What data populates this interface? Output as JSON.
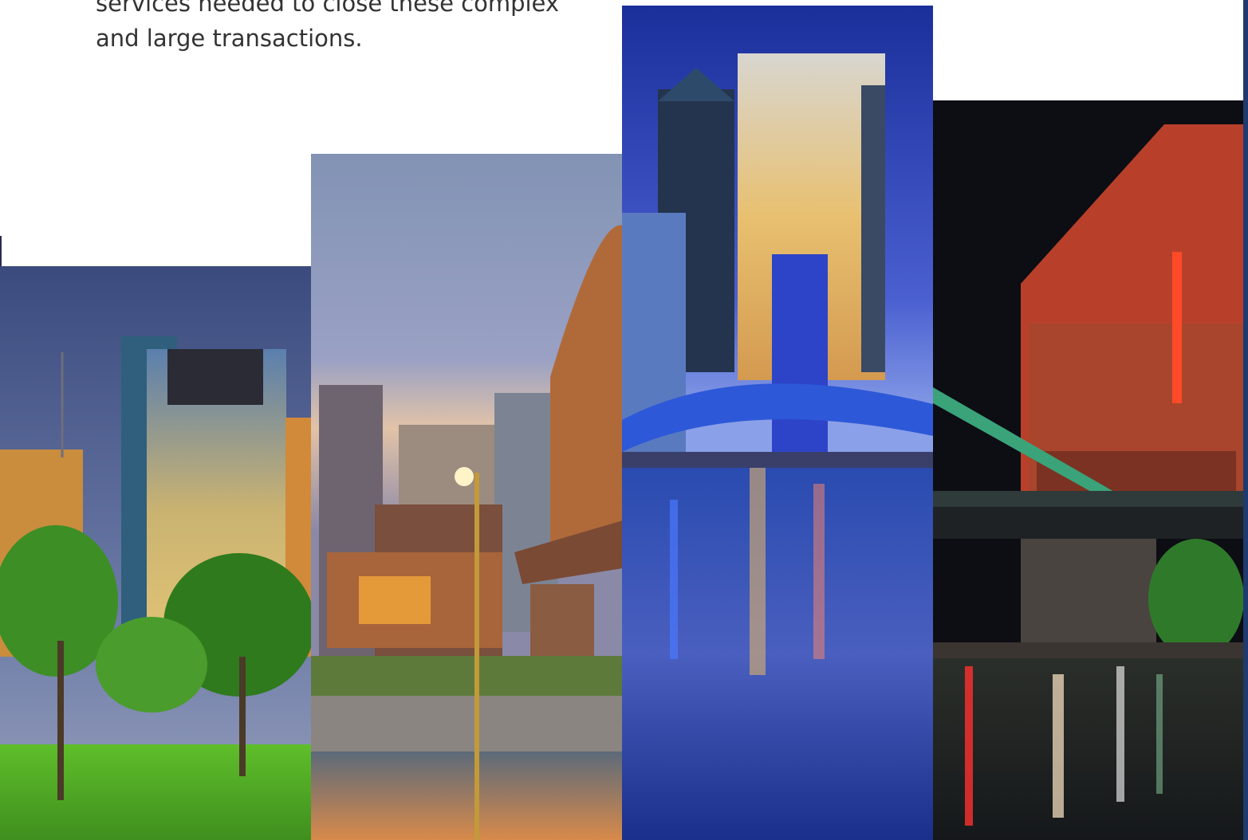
{
  "intro": {
    "line1": "services needed to close these complex",
    "line2": "and large transactions."
  },
  "gallery": {
    "panels": [
      {
        "name": "skyline-park-photo",
        "theme": "city skyline over park at dusk"
      },
      {
        "name": "bridge-downtown-photo",
        "theme": "arched bridge and downtown at sunset"
      },
      {
        "name": "blue-bridge-river-photo",
        "theme": "blue lit bridge with towers over river"
      },
      {
        "name": "riverwalk-night-photo",
        "theme": "red brick building on riverwalk at night"
      }
    ]
  },
  "colors": {
    "text": "#333333",
    "accent": "#1f3a6e"
  }
}
